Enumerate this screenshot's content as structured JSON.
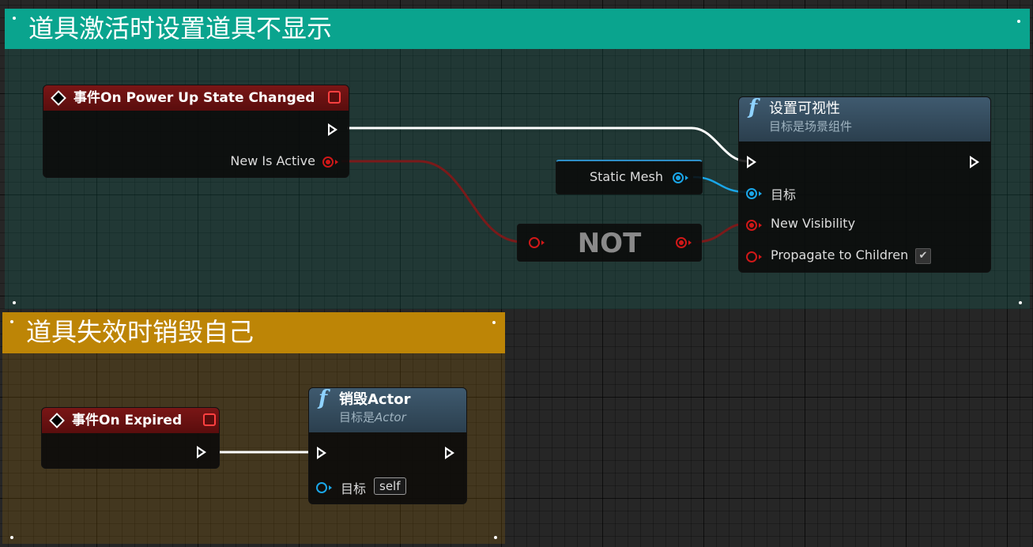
{
  "comments": {
    "activate": {
      "title": "道具激活时设置道具不显示",
      "color": "#0aa48e"
    },
    "expire": {
      "title": "道具失效时销毁自己",
      "color": "#bd8506"
    }
  },
  "nodes": {
    "power_up_event": {
      "title": "事件On Power Up State Changed",
      "output_label": "New Is Active"
    },
    "static_mesh": {
      "label": "Static Mesh"
    },
    "not_node": {
      "label": "NOT"
    },
    "set_visibility": {
      "title": "设置可视性",
      "subtitle": "目标是场景组件",
      "target_label": "目标",
      "new_visibility_label": "New Visibility",
      "propagate_label": "Propagate to Children",
      "propagate_checked": true
    },
    "expired_event": {
      "title": "事件On Expired"
    },
    "destroy_actor": {
      "title": "销毁Actor",
      "subtitle_prefix": "目标是",
      "subtitle_class": "Actor",
      "target_label": "目标",
      "target_value": "self"
    }
  },
  "icons": {
    "event": "diamond-icon",
    "function": "function-icon",
    "exec_pin": "exec-pin-icon",
    "data_pin": "data-pin-icon"
  },
  "colors": {
    "bool_wire": "#7a1a1a",
    "object_wire": "#1aa6e8",
    "exec_wire": "#ffffff"
  }
}
